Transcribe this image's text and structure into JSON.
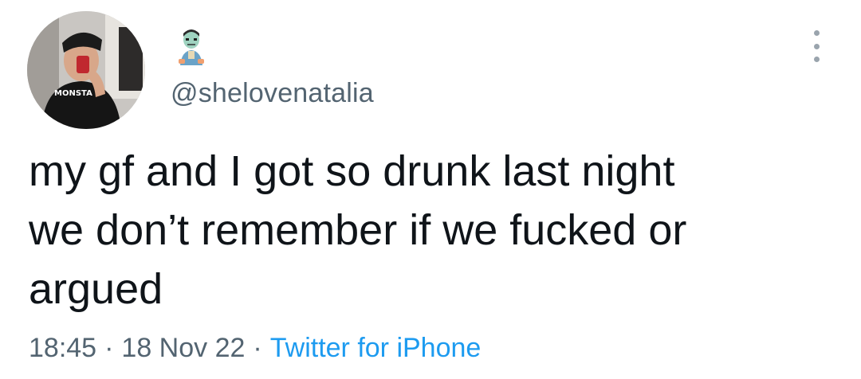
{
  "tweet": {
    "author": {
      "avatar": "profile-photo-mirror-selfie",
      "display_name_icon": "zombie-emoji",
      "handle": "@shelovenatalia"
    },
    "text": "my gf and I got so drunk last night\nwe don’t remember if we fucked or\nargued",
    "time": "18:45",
    "separator": "·",
    "date": "18 Nov 22",
    "source": "Twitter for iPhone",
    "menu_icon": "more-options-icon"
  },
  "colors": {
    "text": "#0f1419",
    "secondary": "#536471",
    "link": "#1d9bf0"
  }
}
